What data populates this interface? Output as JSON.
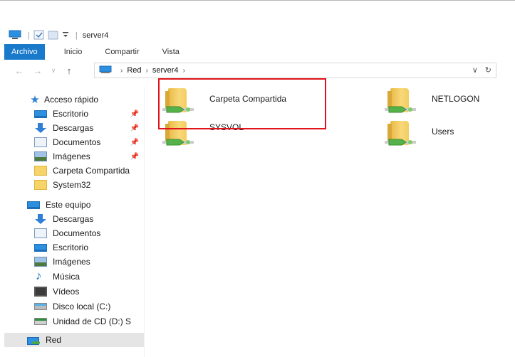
{
  "window": {
    "title": "server4"
  },
  "ribbon": {
    "tabs": [
      {
        "label": "Archivo",
        "active": true
      },
      {
        "label": "Inicio",
        "active": false
      },
      {
        "label": "Compartir",
        "active": false
      },
      {
        "label": "Vista",
        "active": false
      }
    ]
  },
  "address": {
    "crumbs": [
      "Red",
      "server4"
    ],
    "nav_icons": [
      "back-arrow",
      "forward-arrow",
      "recent-chevron",
      "up-arrow"
    ]
  },
  "sidebar": {
    "quick_access": {
      "label": "Acceso rápido",
      "items": [
        {
          "label": "Escritorio",
          "icon": "desktop-icon",
          "pinned": true
        },
        {
          "label": "Descargas",
          "icon": "downloads-icon",
          "pinned": true
        },
        {
          "label": "Documentos",
          "icon": "documents-icon",
          "pinned": true
        },
        {
          "label": "Imágenes",
          "icon": "pictures-icon",
          "pinned": true
        },
        {
          "label": "Carpeta Compartida",
          "icon": "folder-icon",
          "pinned": false
        },
        {
          "label": "System32",
          "icon": "folder-icon",
          "pinned": false
        }
      ]
    },
    "this_pc": {
      "label": "Este equipo",
      "items": [
        {
          "label": "Descargas",
          "icon": "downloads-icon"
        },
        {
          "label": "Documentos",
          "icon": "documents-icon"
        },
        {
          "label": "Escritorio",
          "icon": "desktop-icon"
        },
        {
          "label": "Imágenes",
          "icon": "pictures-icon"
        },
        {
          "label": "Música",
          "icon": "music-icon"
        },
        {
          "label": "Vídeos",
          "icon": "videos-icon"
        },
        {
          "label": "Disco local (C:)",
          "icon": "local-disk-icon"
        },
        {
          "label": "Unidad de CD (D:) S",
          "icon": "cd-drive-icon"
        }
      ]
    },
    "network": {
      "label": "Red",
      "selected": true
    }
  },
  "content": {
    "shares": [
      {
        "label": "Carpeta Compartida",
        "highlighted": true
      },
      {
        "label": "NETLOGON",
        "highlighted": false
      },
      {
        "label": "SYSVOL",
        "highlighted": false
      },
      {
        "label": "Users",
        "highlighted": false
      }
    ]
  },
  "colors": {
    "accent": "#1979ca",
    "highlight_box": "#e0141a",
    "folder": "#f6d46a"
  }
}
